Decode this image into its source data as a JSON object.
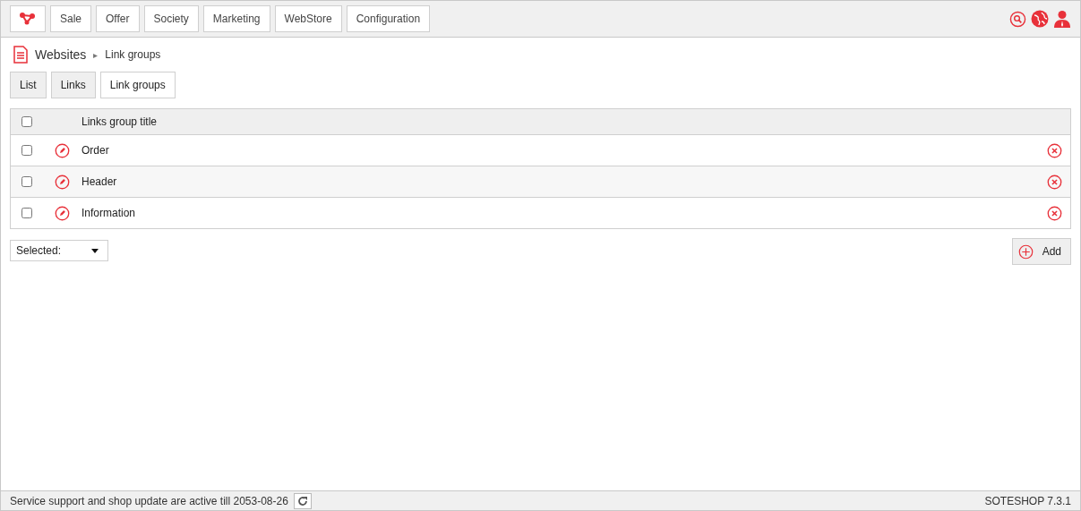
{
  "menu": [
    {
      "label": "Sale"
    },
    {
      "label": "Offer"
    },
    {
      "label": "Society"
    },
    {
      "label": "Marketing"
    },
    {
      "label": "WebStore"
    },
    {
      "label": "Configuration"
    }
  ],
  "breadcrumb": {
    "section": "Websites",
    "separator": "▸",
    "current": "Link groups"
  },
  "tabs": [
    {
      "label": "List",
      "selected": false
    },
    {
      "label": "Links",
      "selected": false
    },
    {
      "label": "Link groups",
      "selected": true
    }
  ],
  "table": {
    "select_all_checked": false,
    "columns": [
      "Links group title"
    ],
    "rows": [
      {
        "title": "Order",
        "checked": false
      },
      {
        "title": "Header",
        "checked": false
      },
      {
        "title": "Information",
        "checked": false
      }
    ]
  },
  "bulk_select": {
    "value": "Selected:"
  },
  "add_button": "Add",
  "status_bar": {
    "message": "Service support and shop update are active till 2053-08-26",
    "version": "SOTESHOP 7.3.1"
  }
}
